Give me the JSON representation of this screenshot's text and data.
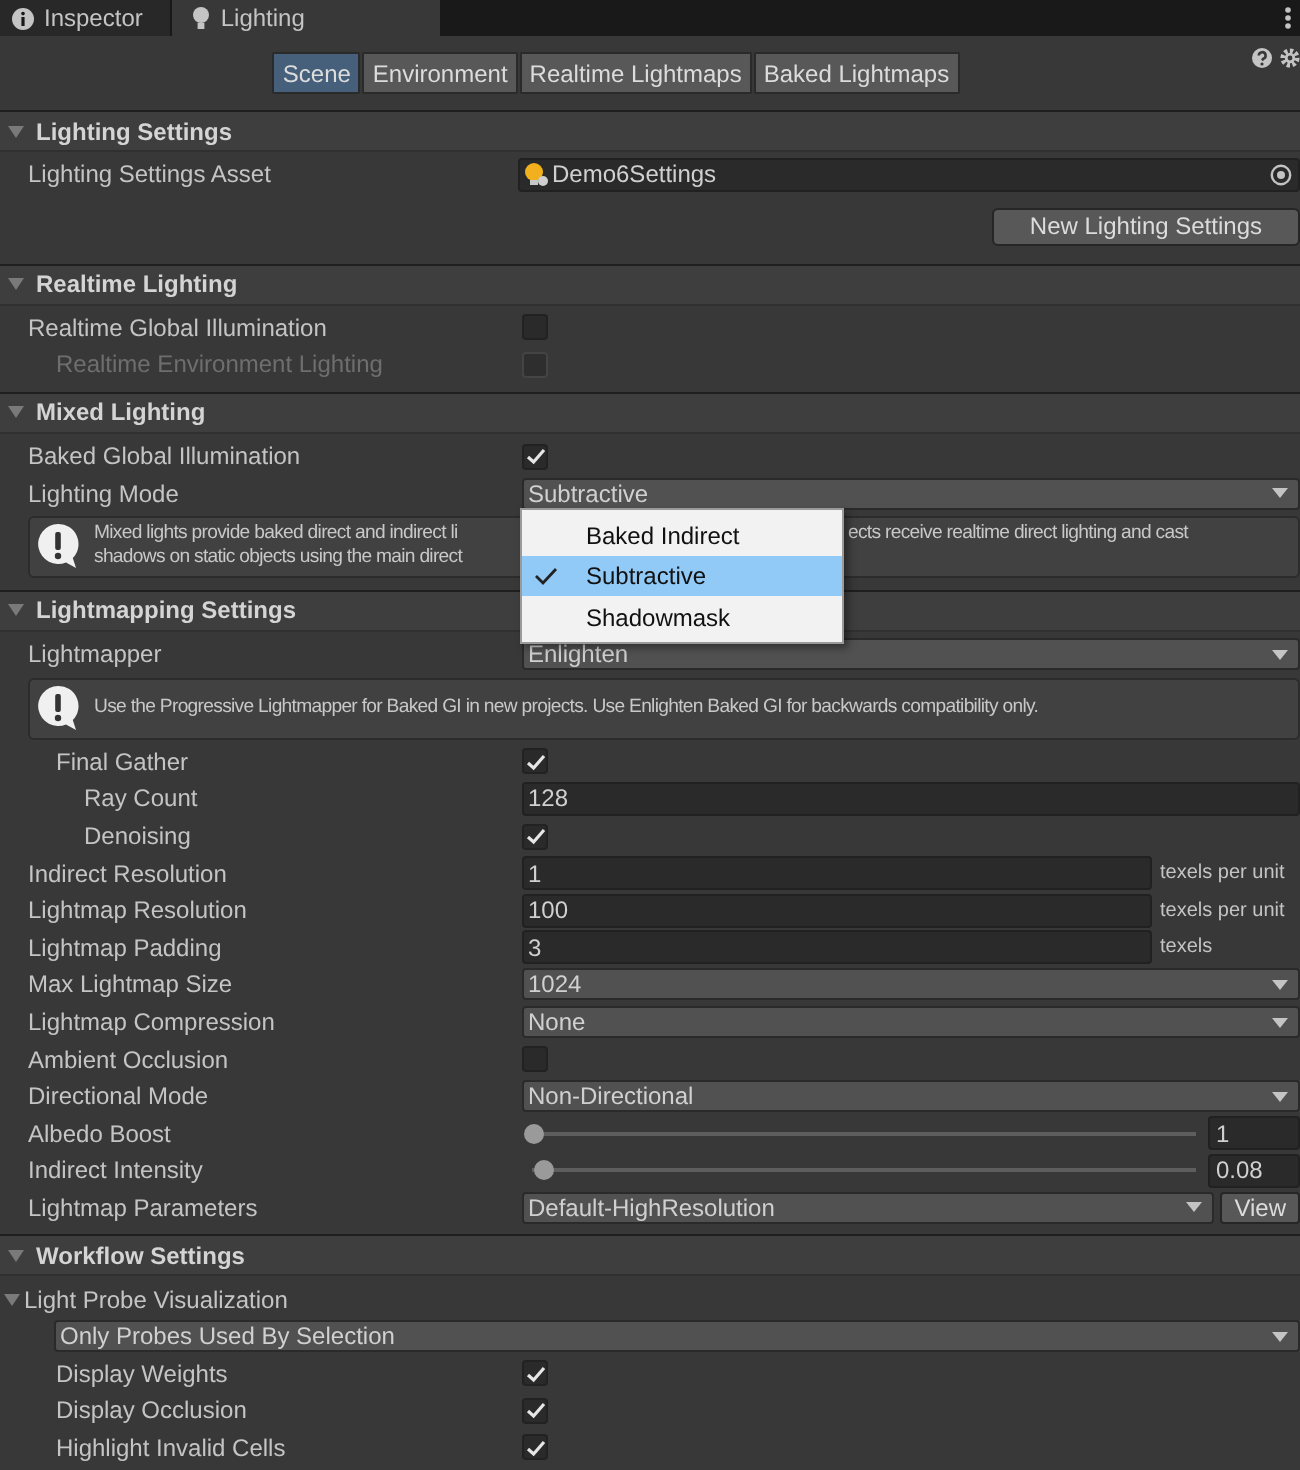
{
  "window_tabs": [
    {
      "label": "Inspector",
      "kind": "info",
      "selected": false
    },
    {
      "label": "Lighting",
      "kind": "bulb",
      "selected": true
    }
  ],
  "toolbar": {
    "tabs": [
      {
        "label": "Scene",
        "selected": true
      },
      {
        "label": "Environment",
        "selected": false
      },
      {
        "label": "Realtime Lightmaps",
        "selected": false
      },
      {
        "label": "Baked Lightmaps",
        "selected": false
      }
    ]
  },
  "sections": [
    {
      "title": "Lighting Settings",
      "expanded": true,
      "rows": [
        {
          "kind": "object",
          "label": "Lighting Settings Asset",
          "value": "Demo6Settings"
        },
        {
          "kind": "button",
          "label": "New Lighting Settings"
        }
      ]
    },
    {
      "title": "Realtime Lighting",
      "expanded": true,
      "rows": [
        {
          "kind": "checkbox",
          "label": "Realtime Global Illumination",
          "checked": false,
          "children": [
            {
              "kind": "checkbox",
              "label": "Realtime Environment Lighting",
              "checked": false,
              "disabled": true
            }
          ]
        }
      ]
    },
    {
      "title": "Mixed Lighting",
      "expanded": true,
      "rows": [
        {
          "kind": "checkbox",
          "label": "Baked Global Illumination",
          "checked": true
        },
        {
          "kind": "dropdown",
          "label": "Lighting Mode",
          "value": "Subtractive",
          "expanded": true,
          "options": [
            {
              "label": "Baked Indirect",
              "selected": false
            },
            {
              "label": "Subtractive",
              "selected": true
            },
            {
              "label": "Shadowmask",
              "selected": false
            }
          ]
        },
        {
          "kind": "help",
          "text_parts": [
            {
              "lines": [
                "Mixed lights provide baked direct and indirect li",
                "shadows on static objects using the main direct"
              ]
            },
            {
              "lines": [
                "ects receive realtime direct lighting and cast"
              ]
            }
          ]
        }
      ]
    },
    {
      "title": "Lightmapping Settings",
      "expanded": true,
      "rows": [
        {
          "kind": "dropdown",
          "label": "Lightmapper",
          "value": "Enlighten",
          "expanded": false,
          "children": [
            {
              "kind": "help",
              "text_parts": [
                {
                  "lines": [
                    "Use the Progressive Lightmapper for Baked GI in new projects. Use Enlighten Baked GI for backwards compatibility only."
                  ]
                }
              ]
            },
            {
              "kind": "checkbox",
              "label": "Final Gather",
              "checked": true,
              "children": [
                {
                  "kind": "field",
                  "label": "Ray Count",
                  "value": "128"
                },
                {
                  "kind": "checkbox",
                  "label": "Denoising",
                  "checked": true
                }
              ]
            }
          ]
        },
        {
          "kind": "field",
          "label": "Indirect Resolution",
          "value": "1",
          "unit": "texels per unit"
        },
        {
          "kind": "field",
          "label": "Lightmap Resolution",
          "value": "100",
          "unit": "texels per unit"
        },
        {
          "kind": "field",
          "label": "Lightmap Padding",
          "value": "3",
          "unit": "texels"
        },
        {
          "kind": "dropdown",
          "label": "Max Lightmap Size",
          "value": "1024",
          "expanded": false
        },
        {
          "kind": "dropdown",
          "label": "Lightmap Compression",
          "value": "None",
          "expanded": false
        },
        {
          "kind": "checkbox",
          "label": "Ambient Occlusion",
          "checked": false
        },
        {
          "kind": "dropdown",
          "label": "Directional Mode",
          "value": "Non-Directional",
          "expanded": false
        },
        {
          "kind": "slider",
          "label": "Albedo Boost",
          "level": 0,
          "reading": "1"
        },
        {
          "kind": "slider",
          "label": "Indirect Intensity",
          "level": 0.016,
          "reading": "0.08"
        },
        {
          "kind": "dropdown",
          "label": "Lightmap Parameters",
          "value": "Default-HighResolution",
          "expanded": false,
          "button": "View"
        }
      ]
    },
    {
      "title": "Workflow Settings",
      "expanded": true,
      "rows": [
        {
          "kind": "foldout",
          "label": "Light Probe Visualization",
          "expanded": true,
          "children": [
            {
              "kind": "dropdown",
              "value": "Only Probes Used By Selection",
              "expanded": false
            },
            {
              "kind": "checkbox",
              "label": "Display Weights",
              "checked": true
            },
            {
              "kind": "checkbox",
              "label": "Display Occlusion",
              "checked": true
            },
            {
              "kind": "checkbox",
              "label": "Highlight Invalid Cells",
              "checked": true
            }
          ]
        }
      ]
    }
  ]
}
